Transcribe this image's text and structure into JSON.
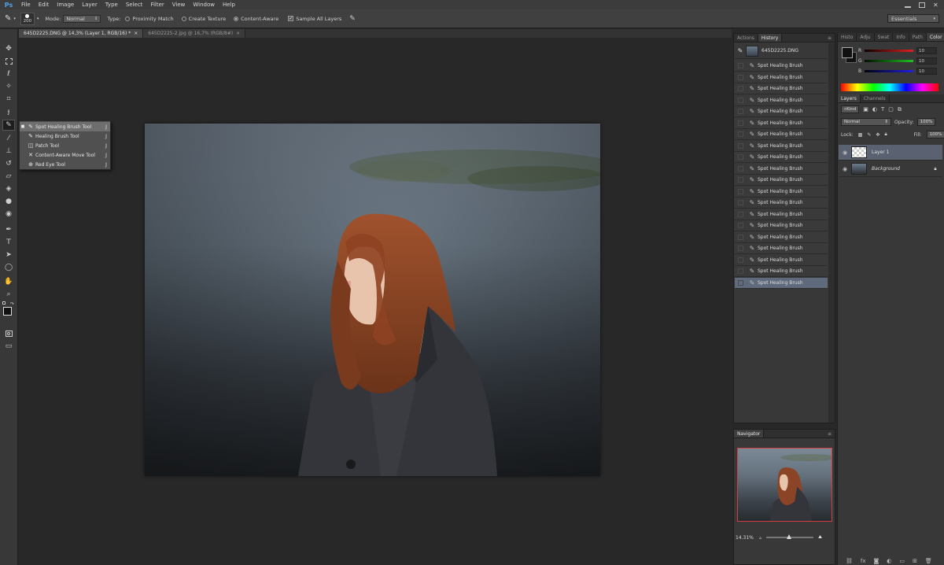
{
  "app": {
    "logo": "Ps"
  },
  "menu": [
    "File",
    "Edit",
    "Image",
    "Layer",
    "Type",
    "Select",
    "Filter",
    "View",
    "Window",
    "Help"
  ],
  "options": {
    "brush_size": "200",
    "mode_label": "Mode:",
    "mode_value": "Normal",
    "type_label": "Type:",
    "type_options": [
      "Proximity Match",
      "Create Texture",
      "Content-Aware"
    ],
    "selected_type": "Content-Aware",
    "sample_all_layers": "Sample All Layers",
    "workspace": "Essentials"
  },
  "tabs": [
    {
      "label": "645D2225.DNG @ 14,3% (Layer 1, RGB/16) *",
      "active": true
    },
    {
      "label": "645D2225-2.jpg @ 16,7% (RGB/8#)",
      "active": false
    }
  ],
  "flyout": [
    {
      "label": "Spot Healing Brush Tool",
      "key": "J",
      "icon": "spot-healing-brush-icon",
      "selected": true
    },
    {
      "label": "Healing Brush Tool",
      "key": "J",
      "icon": "healing-brush-icon",
      "selected": false
    },
    {
      "label": "Patch Tool",
      "key": "J",
      "icon": "patch-icon",
      "selected": false
    },
    {
      "label": "Content-Aware Move Tool",
      "key": "J",
      "icon": "content-aware-move-icon",
      "selected": false
    },
    {
      "label": "Red Eye Tool",
      "key": "J",
      "icon": "red-eye-icon",
      "selected": false
    }
  ],
  "history": {
    "tabs": [
      "Actions",
      "History"
    ],
    "active_tab": "History",
    "snapshot": "645D2225.DNG",
    "entries": [
      "Spot Healing Brush",
      "Spot Healing Brush",
      "Spot Healing Brush",
      "Spot Healing Brush",
      "Spot Healing Brush",
      "Spot Healing Brush",
      "Spot Healing Brush",
      "Spot Healing Brush",
      "Spot Healing Brush",
      "Spot Healing Brush",
      "Spot Healing Brush",
      "Spot Healing Brush",
      "Spot Healing Brush",
      "Spot Healing Brush",
      "Spot Healing Brush",
      "Spot Healing Brush",
      "Spot Healing Brush",
      "Spot Healing Brush",
      "Spot Healing Brush",
      "Spot Healing Brush"
    ],
    "selected_index": 19
  },
  "navigator": {
    "title": "Navigator",
    "zoom": "14.31%"
  },
  "color_panel": {
    "tabs": [
      "Histo",
      "Adju",
      "Swat",
      "Info",
      "Path",
      "Color"
    ],
    "active_tab": "Color",
    "channels": [
      {
        "label": "R",
        "value": "10",
        "color": "#d02020"
      },
      {
        "label": "G",
        "value": "10",
        "color": "#20a020"
      },
      {
        "label": "B",
        "value": "10",
        "color": "#2020d0"
      }
    ]
  },
  "layers_panel": {
    "tabs": [
      "Layers",
      "Channels"
    ],
    "active_tab": "Layers",
    "filter": "Kind",
    "blend_mode": "Normal",
    "opacity_label": "Opacity:",
    "opacity": "100%",
    "lock_label": "Lock:",
    "fill_label": "Fill:",
    "fill": "100%",
    "layers": [
      {
        "name": "Layer 1",
        "selected": true,
        "transparent": true
      },
      {
        "name": "Background",
        "selected": false,
        "transparent": false,
        "locked": true
      }
    ]
  }
}
